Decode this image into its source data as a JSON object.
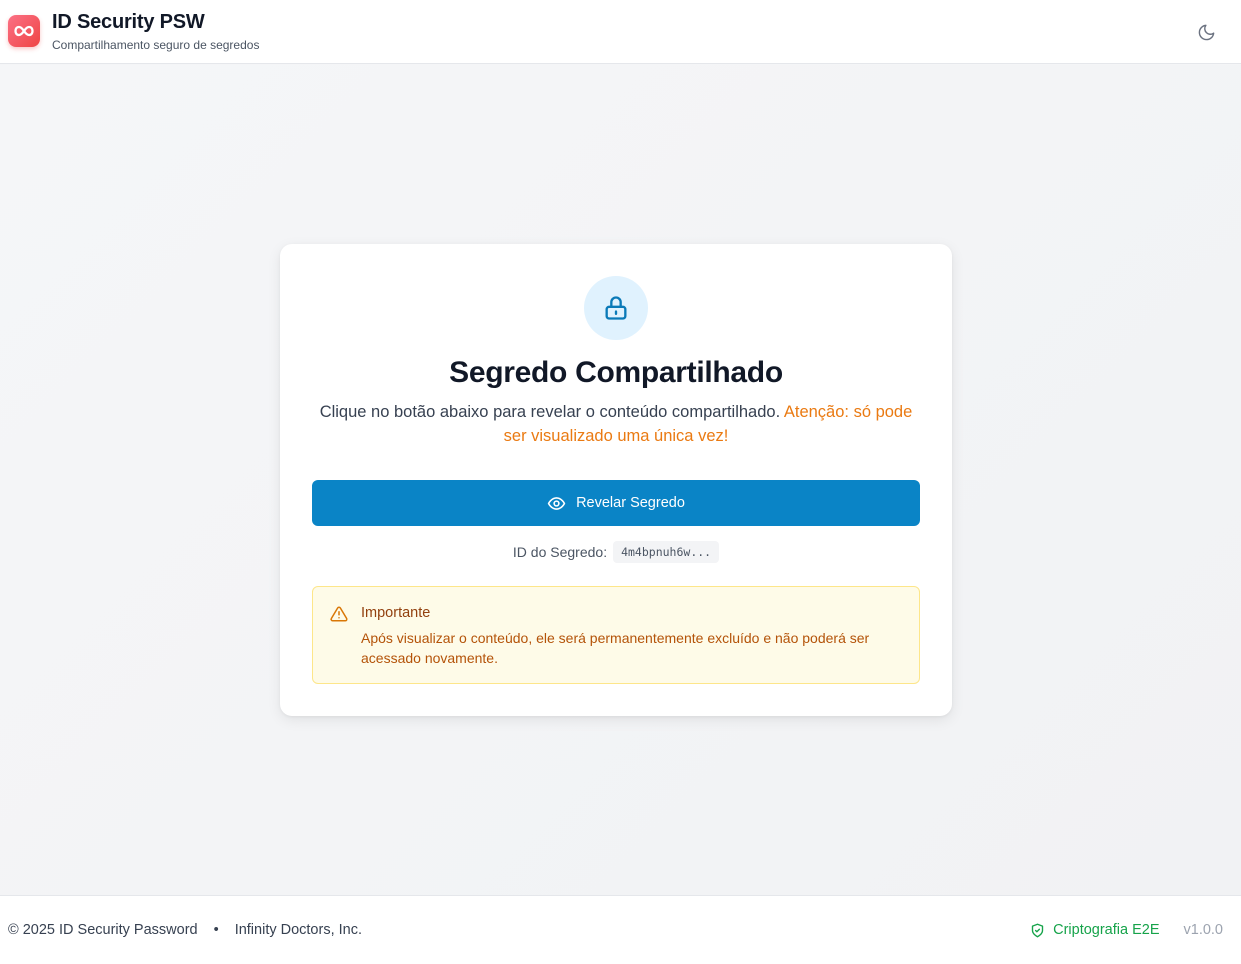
{
  "header": {
    "title": "ID Security PSW",
    "subtitle": "Compartilhamento seguro de segredos",
    "logo_icon": "infinity-icon",
    "theme_icon": "moon-icon"
  },
  "card": {
    "icon": "lock-icon",
    "title": "Segredo Compartilhado",
    "description": "Clique no botão abaixo para revelar o conteúdo compartilhado.",
    "warning": "Atenção: só pode ser visualizado uma única vez!",
    "reveal_button": {
      "icon": "eye-icon",
      "label": "Revelar Segredo"
    },
    "secret_id": {
      "label": "ID do Segredo:",
      "value": "4m4bpnuh6w..."
    },
    "alert": {
      "icon": "warning-triangle-icon",
      "title": "Importante",
      "text": "Após visualizar o conteúdo, ele será permanentemente excluído e não poderá ser acessado novamente."
    }
  },
  "footer": {
    "copyright": "© 2025 ID Security Password",
    "separator": "•",
    "company": "Infinity Doctors, Inc.",
    "encryption": {
      "icon": "shield-check-icon",
      "label": "Criptografia E2E"
    },
    "version": "v1.0.0"
  },
  "colors": {
    "brand_gradient": [
      "#fb7185",
      "#ef4444"
    ],
    "primary_button": "#0a84c6",
    "warning_text": "#ea7a12",
    "alert_background": "#fefbe8",
    "alert_border": "#fde68a",
    "success": "#16a34a"
  }
}
